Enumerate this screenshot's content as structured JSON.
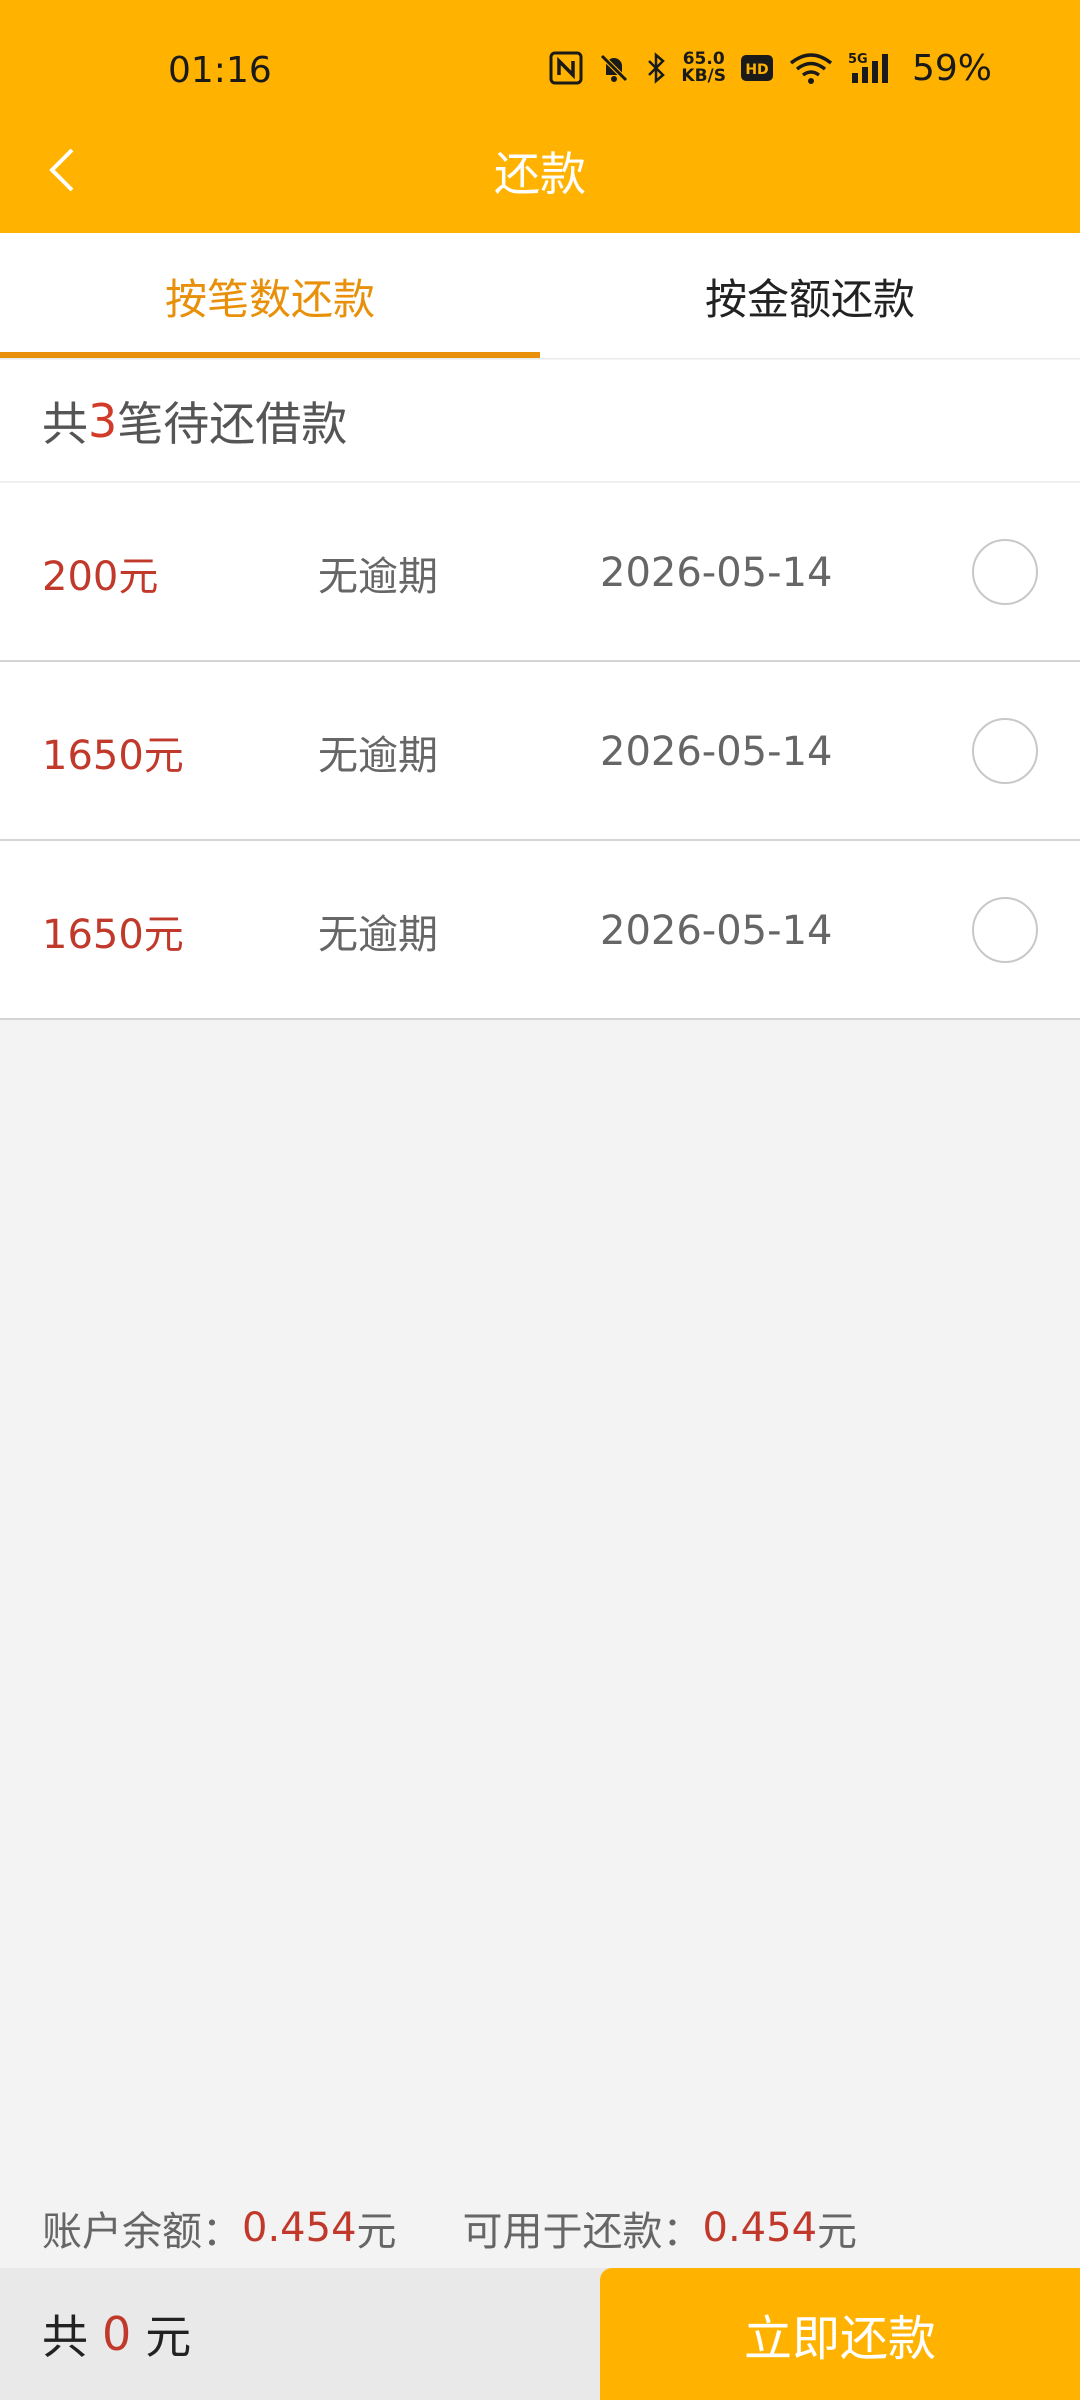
{
  "status_bar": {
    "time": "01:16",
    "net_speed_value": "65.0",
    "net_speed_unit": "KB/S",
    "battery": "59%",
    "icons": [
      "nfc-icon",
      "bell-muted-icon",
      "bluetooth-icon",
      "hd-icon",
      "wifi-icon",
      "signal-5g-icon"
    ]
  },
  "header": {
    "title": "还款",
    "back_icon": "chevron-left-icon"
  },
  "tabs": [
    {
      "label": "按笔数还款",
      "active": true
    },
    {
      "label": "按金额还款",
      "active": false
    }
  ],
  "summary": {
    "prefix": "共",
    "count": "3",
    "suffix": "笔待还借款"
  },
  "loans": [
    {
      "amount": "200元",
      "status": "无逾期",
      "date": "2026-05-14",
      "selected": false
    },
    {
      "amount": "1650元",
      "status": "无逾期",
      "date": "2026-05-14",
      "selected": false
    },
    {
      "amount": "1650元",
      "status": "无逾期",
      "date": "2026-05-14",
      "selected": false
    }
  ],
  "balance": {
    "account_label": "账户余额：",
    "account_value": "0.454",
    "account_unit": "元",
    "available_label": "可用于还款：",
    "available_value": "0.454",
    "available_unit": "元"
  },
  "footer": {
    "total_prefix": "共",
    "total_value": "0",
    "total_unit": "元",
    "pay_button": "立即还款"
  },
  "colors": {
    "brand": "#FFB300",
    "accent": "#E8900A",
    "amount": "#C0392B"
  }
}
